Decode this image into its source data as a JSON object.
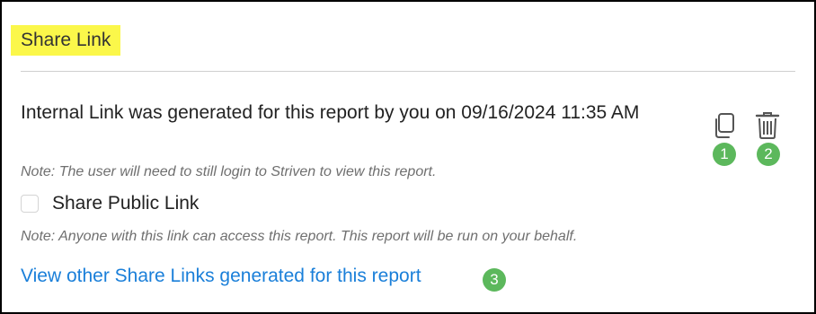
{
  "panel": {
    "title": "Share Link",
    "generated_message": "Internal Link was generated for this report by you on 09/16/2024 11:35 AM",
    "internal_note": "Note: The user will need to still login to Striven to view this report.",
    "share_public": {
      "label": "Share Public Link",
      "checked": false
    },
    "public_note": "Note: Anyone with this link can access this report. This report will be run on your behalf.",
    "view_links_text": "View other Share Links generated for this report"
  },
  "actions": {
    "copy_icon": "copy-icon",
    "delete_icon": "trash-icon"
  },
  "badges": {
    "copy": "1",
    "delete": "2",
    "view_links": "3"
  },
  "colors": {
    "title_highlight": "#fbf74a",
    "link": "#1a7fd9",
    "badge": "#5cb85c",
    "note_text": "#6f6f6f",
    "icon": "#555555"
  }
}
